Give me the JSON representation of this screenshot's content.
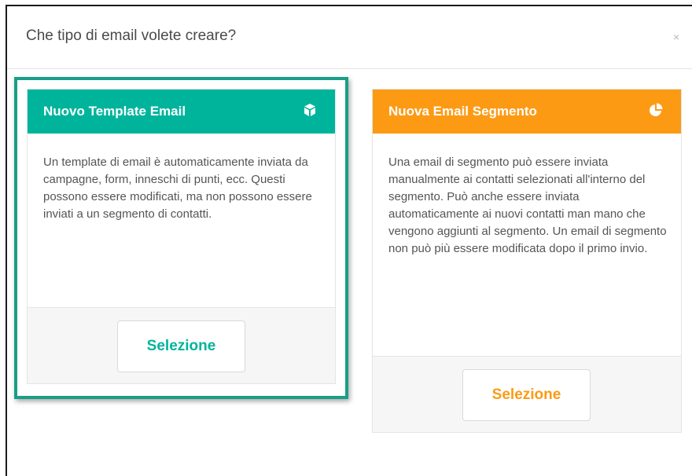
{
  "modal": {
    "title": "Che tipo di email volete creare?",
    "close_label": "×"
  },
  "cards": [
    {
      "title": "Nuovo Template Email",
      "icon": "cube-icon",
      "description": "Un template di email è automaticamente inviata da campagne, form, inneschi di punti, ecc. Questi possono essere modificati, ma non possono essere inviati a un segmento di contatti.",
      "button_label": "Selezione",
      "accent": "#00b49c",
      "highlighted": true
    },
    {
      "title": "Nuova Email Segmento",
      "icon": "pie-chart-icon",
      "description": "Una email di segmento può essere inviata manualmente ai contatti selezionati all'interno del segmento. Può anche essere inviata automaticamente ai nuovi contatti man mano che vengono aggiunti al segmento. Un email di segmento non può più essere modificata dopo il primo invio.",
      "button_label": "Selezione",
      "accent": "#fd9a14",
      "highlighted": false
    }
  ],
  "highlight_color": "#1a9e86"
}
